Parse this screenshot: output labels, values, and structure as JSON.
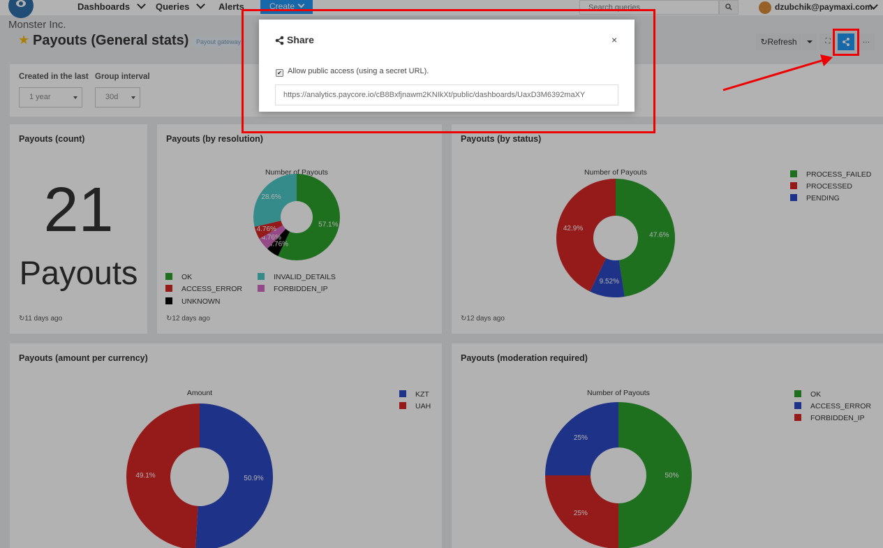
{
  "topnav": {
    "brand": "Monster Inc.",
    "items": [
      "Dashboards",
      "Queries",
      "Alerts"
    ],
    "create_label": "Create",
    "search_placeholder": "Search queries",
    "user": "dzubchik@paymaxi.com"
  },
  "dashboard": {
    "title": "Payouts (General stats)",
    "tag": "Payout gateway",
    "refresh_label": "Refresh"
  },
  "filters": {
    "created_label": "Created in the last",
    "created_value": "1 year",
    "group_label": "Group interval",
    "group_value": "30d"
  },
  "widgets": {
    "count": {
      "title": "Payouts (count)",
      "value": "21",
      "label": "Payouts",
      "updated": "11 days ago"
    },
    "resolution": {
      "title": "Payouts (by resolution)",
      "updated": "12 days ago"
    },
    "status": {
      "title": "Payouts (by status)",
      "updated": "12 days ago"
    },
    "currency": {
      "title": "Payouts (amount per currency)"
    },
    "moderation": {
      "title": "Payouts (moderation required)"
    }
  },
  "modal": {
    "title": "Share",
    "checkbox_label": "Allow public access (using a secret URL).",
    "url": "https://analytics.paycore.io/cB8Bxfjnawm2KNIkXt/public/dashboards/UaxD3M6392maXY"
  },
  "colors": {
    "green": "#2ca02c",
    "red": "#d62728",
    "blue": "#2b48c2",
    "teal": "#4dc8c6",
    "pink": "#d46bc0",
    "black": "#000000",
    "accent": "#2196f3",
    "annotation": "#ee0000"
  },
  "chart_data": [
    {
      "type": "pie",
      "title": "Number of Payouts",
      "categories": [
        "OK",
        "ACCESS_ERROR",
        "UNKNOWN",
        "INVALID_DETAILS",
        "FORBIDDEN_IP"
      ],
      "values": [
        57.1,
        4.76,
        4.76,
        28.6,
        4.76
      ],
      "slice_order": [
        "OK",
        "UNKNOWN",
        "FORBIDDEN_IP",
        "ACCESS_ERROR",
        "INVALID_DETAILS"
      ],
      "slice_values": [
        57.1,
        4.76,
        4.76,
        4.76,
        28.6
      ],
      "slice_labels": [
        "57.1%",
        "4.76%",
        "4.76%",
        "4.76%",
        "28.6%"
      ],
      "slice_colors": [
        "#2ca02c",
        "#000000",
        "#d46bc0",
        "#d62728",
        "#4dc8c6"
      ],
      "legend": [
        "OK",
        "INVALID_DETAILS",
        "ACCESS_ERROR",
        "FORBIDDEN_IP",
        "UNKNOWN"
      ],
      "legend_colors": [
        "#2ca02c",
        "#4dc8c6",
        "#d62728",
        "#d46bc0",
        "#000000"
      ],
      "legend_position": "bottom"
    },
    {
      "type": "pie",
      "title": "Number of Payouts",
      "categories": [
        "PROCESS_FAILED",
        "PROCESSED",
        "PENDING"
      ],
      "values": [
        47.6,
        42.9,
        9.52
      ],
      "slice_order": [
        "PROCESS_FAILED",
        "PENDING",
        "PROCESSED"
      ],
      "slice_values": [
        47.6,
        9.52,
        42.9
      ],
      "slice_labels": [
        "47.6%",
        "9.52%",
        "42.9%"
      ],
      "slice_colors": [
        "#2ca02c",
        "#2b48c2",
        "#d62728"
      ],
      "legend": [
        "PROCESS_FAILED",
        "PROCESSED",
        "PENDING"
      ],
      "legend_colors": [
        "#2ca02c",
        "#d62728",
        "#2b48c2"
      ],
      "legend_position": "right"
    },
    {
      "type": "pie",
      "title": "Amount",
      "categories": [
        "KZT",
        "UAH"
      ],
      "values": [
        50.9,
        49.1
      ],
      "slice_order": [
        "KZT",
        "UAH"
      ],
      "slice_values": [
        50.9,
        49.1
      ],
      "slice_labels": [
        "50.9%",
        "49.1%"
      ],
      "slice_colors": [
        "#2b48c2",
        "#d62728"
      ],
      "legend": [
        "KZT",
        "UAH"
      ],
      "legend_colors": [
        "#2b48c2",
        "#d62728"
      ],
      "legend_position": "right"
    },
    {
      "type": "pie",
      "title": "Number of Payouts",
      "categories": [
        "OK",
        "ACCESS_ERROR",
        "FORBIDDEN_IP"
      ],
      "values": [
        50,
        25,
        25
      ],
      "slice_order": [
        "OK",
        "FORBIDDEN_IP",
        "ACCESS_ERROR"
      ],
      "slice_values": [
        50,
        25,
        25
      ],
      "slice_labels": [
        "50%",
        "25%",
        "25%"
      ],
      "slice_colors": [
        "#2ca02c",
        "#d62728",
        "#2b48c2"
      ],
      "legend": [
        "OK",
        "ACCESS_ERROR",
        "FORBIDDEN_IP"
      ],
      "legend_colors": [
        "#2ca02c",
        "#2b48c2",
        "#d62728"
      ],
      "legend_position": "right"
    }
  ]
}
